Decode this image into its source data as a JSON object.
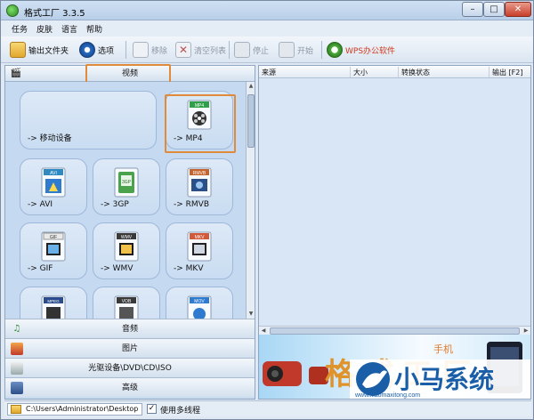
{
  "window": {
    "title": "格式工厂 3.3.5",
    "min_symbol": "–",
    "max_symbol": "□",
    "close_symbol": "✕"
  },
  "menu": [
    "任务",
    "皮肤",
    "语言",
    "帮助"
  ],
  "toolbar": {
    "output_folder": "输出文件夹",
    "options": "选项",
    "remove": "移除",
    "clear_list": "清空列表",
    "stop": "停止",
    "start": "开始",
    "wps": "WPS办公软件"
  },
  "left_panel": {
    "video_category": "视频",
    "formats": [
      {
        "label": "-> 移动设备",
        "icon": "mobile-device-icon",
        "badge": ""
      },
      {
        "label": "-> MP4",
        "icon": "mp4-file-icon",
        "badge": "MP4"
      },
      {
        "label": "-> AVI",
        "icon": "avi-file-icon",
        "badge": "AVI"
      },
      {
        "label": "-> 3GP",
        "icon": "3gp-file-icon",
        "badge": "3GP"
      },
      {
        "label": "-> RMVB",
        "icon": "rmvb-file-icon",
        "badge": "RMVB"
      },
      {
        "label": "-> GIF",
        "icon": "gif-file-icon",
        "badge": "GIF"
      },
      {
        "label": "-> WMV",
        "icon": "wmv-file-icon",
        "badge": "WMV"
      },
      {
        "label": "-> MKV",
        "icon": "mkv-file-icon",
        "badge": "MKV"
      },
      {
        "label": "",
        "icon": "mpeg-file-icon",
        "badge": "MPEG"
      },
      {
        "label": "",
        "icon": "vob-file-icon",
        "badge": "VOB"
      },
      {
        "label": "",
        "icon": "mov-file-icon",
        "badge": "MOV"
      }
    ],
    "categories": [
      {
        "label": "音频",
        "icon": "music-note-icon"
      },
      {
        "label": "图片",
        "icon": "picture-icon"
      },
      {
        "label": "光驱设备\\DVD\\CD\\ISO",
        "icon": "optical-drive-icon"
      },
      {
        "label": "高级",
        "icon": "toolbox-icon"
      }
    ]
  },
  "task_list": {
    "columns": [
      "来源",
      "大小",
      "转换状态",
      "输出 [F2]"
    ]
  },
  "banner": {
    "brand_chars": "格 式 工 厂",
    "watermark": "小马系统",
    "watermark_url": "www.xiaomaxitong.com",
    "mobile_tag": "手机"
  },
  "status": {
    "output_path": "C:\\Users\\Administrator\\Desktop",
    "multithread_label": "使用多线程",
    "multithread_checked": true,
    "check_mark": "✓"
  },
  "colors": {
    "highlight": "#e08a3c",
    "watermark_blue": "#1a5ea8"
  }
}
